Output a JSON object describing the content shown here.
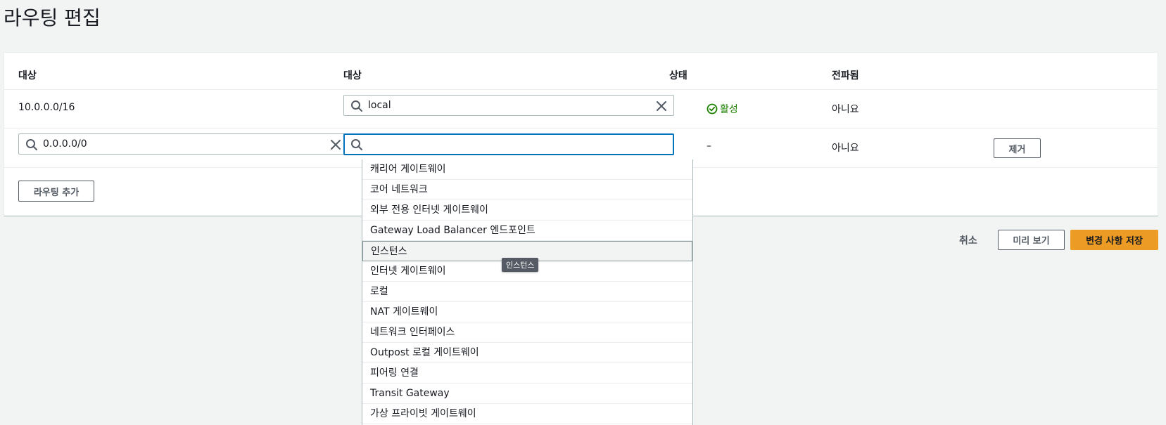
{
  "page": {
    "title": "라우팅 편집"
  },
  "table": {
    "headers": [
      "대상",
      "대상",
      "상태",
      "전파됨"
    ],
    "rows": [
      {
        "destination": "10.0.0.0/16",
        "target_value": "local",
        "status": "활성",
        "propagated": "아니요"
      },
      {
        "destination_value": "0.0.0.0/0",
        "target_value": "",
        "status": "–",
        "propagated": "아니요",
        "remove_label": "제거"
      }
    ],
    "add_route_label": "라우팅 추가"
  },
  "dropdown": {
    "options": [
      "캐리어 게이트웨이",
      "코어 네트워크",
      "외부 전용 인터넷 게이트웨이",
      "Gateway Load Balancer 엔드포인트",
      "인스턴스",
      "인터넷 게이트웨이",
      "로컬",
      "NAT 게이트웨이",
      "네트워크 인터페이스",
      "Outpost 로컬 게이트웨이",
      "피어링 연결",
      "Transit Gateway",
      "가상 프라이빗 게이트웨이"
    ],
    "highlighted": "인스턴스",
    "tooltip": "인스턴스"
  },
  "footer": {
    "cancel_label": "취소",
    "preview_label": "미리 보기",
    "save_label": "변경 사항 저장"
  },
  "colors": {
    "accent": "#ec9b24",
    "focus": "#0073bb",
    "success": "#1d8102"
  },
  "icons": {
    "search": "search-icon",
    "clear": "close-icon",
    "status": "check-circle-icon"
  }
}
